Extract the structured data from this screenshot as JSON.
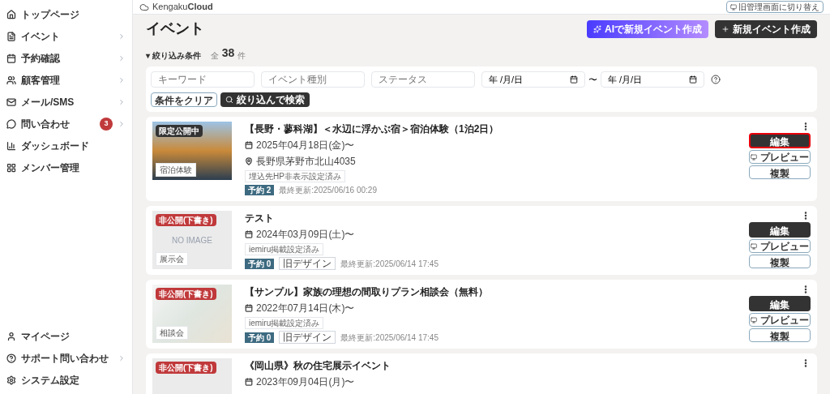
{
  "sidebar": {
    "items": [
      {
        "label": "トップページ",
        "chevron": false
      },
      {
        "label": "イベント",
        "chevron": true
      },
      {
        "label": "予約確認",
        "chevron": true
      },
      {
        "label": "顧客管理",
        "chevron": true
      },
      {
        "label": "メール/SMS",
        "chevron": true
      },
      {
        "label": "問い合わせ",
        "chevron": true,
        "badge": "3"
      },
      {
        "label": "ダッシュボード",
        "chevron": false
      },
      {
        "label": "メンバー管理",
        "chevron": false
      }
    ],
    "bottom_items": [
      {
        "label": "マイページ",
        "chevron": false
      },
      {
        "label": "サポート問い合わせ",
        "chevron": true
      },
      {
        "label": "システム設定",
        "chevron": false
      }
    ]
  },
  "header": {
    "logo_light": "Kengaku",
    "logo_bold": "Cloud",
    "switch_button": "旧管理画面に切り替え"
  },
  "page": {
    "title": "イベント",
    "ai_button": "AIで新規イベント作成",
    "new_button": "新規イベント作成"
  },
  "filter": {
    "toggle": "▾ 絞り込み条件",
    "total_prefix": "全",
    "total": "38",
    "total_suffix": "件",
    "fields": [
      {
        "placeholder": "キーワード"
      },
      {
        "placeholder": "イベント種別"
      },
      {
        "placeholder": "ステータス"
      }
    ],
    "date_from": "年 /月/日",
    "tilde": "〜",
    "date_to": "年 /月/日",
    "clear_button": "条件をクリア",
    "search_button": "絞り込んで検索"
  },
  "events": [
    {
      "title": "【長野・蓼科湖】＜水辺に浮かぶ宿＞宿泊体験（1泊2日）",
      "status": "限定公開中",
      "kind": "limited",
      "category": "宿泊体験",
      "date": "2025年04月18日(金)〜",
      "location": "長野県茅野市北山4035",
      "tags": [
        "埋込先HP非表示設定済み"
      ],
      "reservations": "予約 2",
      "updated": "最終更新:2025/06/16 00:29",
      "edit": "編集",
      "preview": "プレビュー",
      "copy": "複製",
      "highlighted": true
    },
    {
      "title": "テスト",
      "status": "非公開(下書き)",
      "kind": "draft",
      "no_image": "NO IMAGE",
      "category": "展示会",
      "date": "2024年03月09日(土)〜",
      "tags": [
        "iemiru掲載設定済み"
      ],
      "reservations": "予約 0",
      "old_design": "旧デザイン",
      "updated": "最終更新:2025/06/14 17:45",
      "edit": "編集",
      "preview": "プレビュー",
      "copy": "複製",
      "highlighted": false
    },
    {
      "title": "【サンプル】家族の理想の間取りプラン相談会（無料）",
      "status": "非公開(下書き)",
      "kind": "draft",
      "category": "相談会",
      "date": "2022年07月14日(木)〜",
      "tags": [
        "iemiru掲載設定済み"
      ],
      "reservations": "予約 0",
      "old_design": "旧デザイン",
      "updated": "最終更新:2025/06/14 17:45",
      "edit": "編集",
      "preview": "プレビュー",
      "copy": "複製",
      "highlighted": false
    },
    {
      "title": "《岡山県》秋の住宅展示イベント",
      "status": "非公開(下書き)",
      "kind": "draft",
      "date": "2023年09月04日(月)〜"
    }
  ]
}
